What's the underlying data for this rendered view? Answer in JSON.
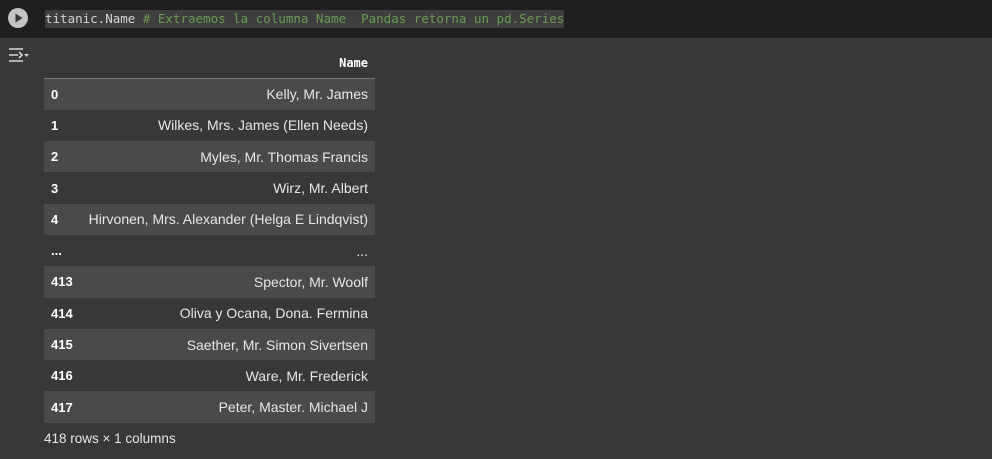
{
  "code": {
    "identifier": "titanic.Name",
    "comment": "# Extraemos la columna Name  Pandas retorna un pd.Series"
  },
  "table": {
    "column_header": "Name",
    "rows": [
      {
        "index": "0",
        "name": "Kelly, Mr. James"
      },
      {
        "index": "1",
        "name": "Wilkes, Mrs. James (Ellen Needs)"
      },
      {
        "index": "2",
        "name": "Myles, Mr. Thomas Francis"
      },
      {
        "index": "3",
        "name": "Wirz, Mr. Albert"
      },
      {
        "index": "4",
        "name": "Hirvonen, Mrs. Alexander (Helga E Lindqvist)"
      },
      {
        "index": "...",
        "name": "..."
      },
      {
        "index": "413",
        "name": "Spector, Mr. Woolf"
      },
      {
        "index": "414",
        "name": "Oliva y Ocana, Dona. Fermina"
      },
      {
        "index": "415",
        "name": "Saether, Mr. Simon Sivertsen"
      },
      {
        "index": "416",
        "name": "Ware, Mr. Frederick"
      },
      {
        "index": "417",
        "name": "Peter, Master. Michael J"
      }
    ]
  },
  "footer": "418 rows × 1 columns",
  "icons": {
    "run": "play-icon",
    "output": "output-toggle-icon"
  },
  "colors": {
    "background": "#383838",
    "code_background": "#1f1f1f",
    "comment": "#6a9955",
    "row_stripe": "#4a4a4a"
  }
}
